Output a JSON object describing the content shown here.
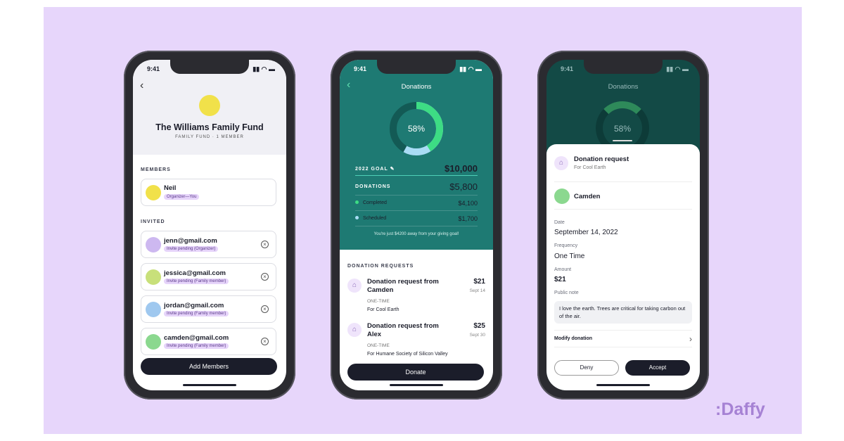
{
  "status_time": "9:41",
  "brand": ":Daffy",
  "fund": {
    "title": "The Williams Family Fund",
    "subtitle": "FAMILY FUND · 1 MEMBER",
    "members_label": "MEMBERS",
    "members": [
      {
        "name": "Neil",
        "role": "Organizer—You"
      }
    ],
    "invited_label": "INVITED",
    "invited": [
      {
        "email": "jenn@gmail.com",
        "status": "Invite pending (Organizer)"
      },
      {
        "email": "jessica@gmail.com",
        "status": "Invite pending (Family member)"
      },
      {
        "email": "jordan@gmail.com",
        "status": "Invite pending (Family member)"
      },
      {
        "email": "camden@gmail.com",
        "status": "Invite pending (Family member)"
      }
    ],
    "add_button": "Add Members"
  },
  "donations": {
    "title": "Donations",
    "progress_percent": 58,
    "progress_label": "58%",
    "goal_label": "2022 GOAL",
    "goal_value": "$10,000",
    "donations_label": "DONATIONS",
    "donations_value": "$5,800",
    "completed_label": "Completed",
    "completed_value": "$4,100",
    "scheduled_label": "Scheduled",
    "scheduled_value": "$1,700",
    "message": "You're just $4200 away from your giving goal!",
    "requests_label": "DONATION REQUESTS",
    "requests": [
      {
        "title": "Donation request from Camden",
        "type": "ONE-TIME",
        "for": "For Cool Earth",
        "amount": "$21",
        "date": "Sept 14"
      },
      {
        "title": "Donation request from Alex",
        "type": "ONE-TIME",
        "for": "For Humane Society of Silicon Valley",
        "amount": "$25",
        "date": "Sept 30"
      }
    ],
    "donate_button": "Donate",
    "colors": {
      "completed": "#3ddc84",
      "scheduled": "#a9dcf5",
      "teal": "#1e7a73"
    }
  },
  "detail": {
    "title": "Donation request",
    "subtitle": "For Cool Earth",
    "requester": "Camden",
    "date_label": "Date",
    "date": "September 14, 2022",
    "frequency_label": "Frequency",
    "frequency": "One Time",
    "amount_label": "Amount",
    "amount": "$21",
    "note_label": "Public note",
    "note": "I love the earth. Trees are critical for taking carbon out of the air.",
    "modify": "Modify donation",
    "deny": "Deny",
    "accept": "Accept"
  }
}
